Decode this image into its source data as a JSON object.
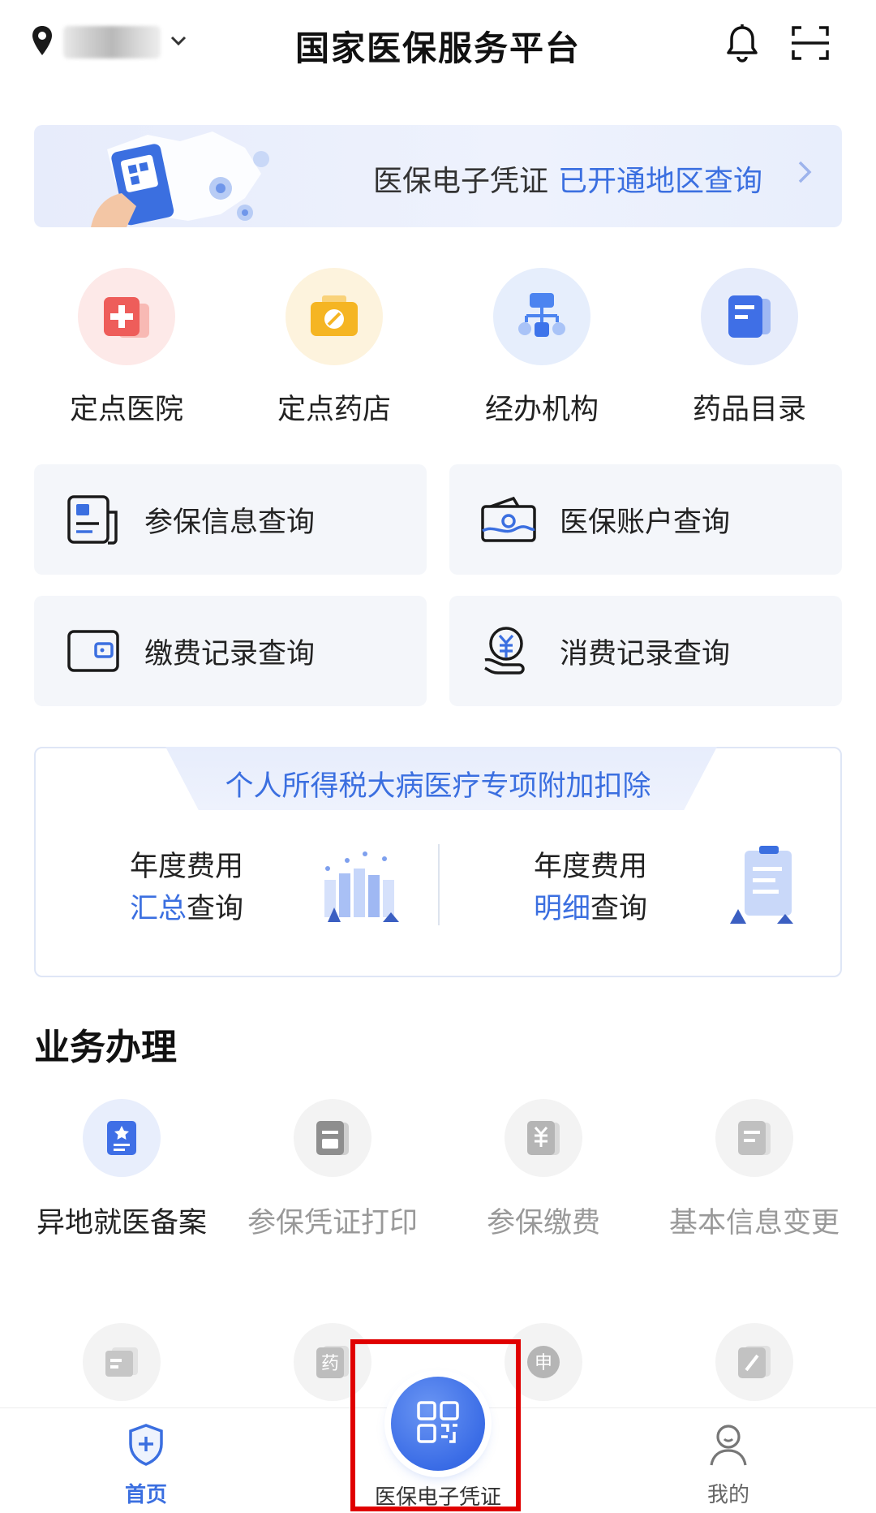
{
  "header": {
    "title": "国家医保服务平台"
  },
  "banner": {
    "text": "医保电子凭证",
    "link": "已开通地区查询"
  },
  "quick": [
    {
      "label": "定点医院",
      "icon": "hospital-icon",
      "color": "#f26464"
    },
    {
      "label": "定点药店",
      "icon": "pharmacy-icon",
      "color": "#f5b92e"
    },
    {
      "label": "经办机构",
      "icon": "agency-icon",
      "color": "#4c84f0"
    },
    {
      "label": "药品目录",
      "icon": "catalog-icon",
      "color": "#3f6fe6"
    }
  ],
  "cards": [
    {
      "label": "参保信息查询",
      "icon": "insurance-info-icon"
    },
    {
      "label": "医保账户查询",
      "icon": "account-wallet-icon"
    },
    {
      "label": "缴费记录查询",
      "icon": "payment-card-icon"
    },
    {
      "label": "消费记录查询",
      "icon": "yuan-hand-icon"
    }
  ],
  "tax": {
    "title": "个人所得税大病医疗专项附加扣除",
    "left": {
      "line1": "年度费用",
      "highlight": "汇总",
      "rest": "查询"
    },
    "right": {
      "line1": "年度费用",
      "highlight": "明细",
      "rest": "查询"
    }
  },
  "section": {
    "title": "业务办理",
    "items": [
      {
        "label": "异地就医备案",
        "icon": "badge-star-icon"
      },
      {
        "label": "参保凭证打印",
        "icon": "print-doc-icon"
      },
      {
        "label": "参保缴费",
        "icon": "yuan-doc-icon"
      },
      {
        "label": "基本信息变更",
        "icon": "edit-doc-icon"
      }
    ],
    "row2": [
      {
        "icon": "card-icon"
      },
      {
        "icon": "medicine-icon",
        "glyph": "药"
      },
      {
        "icon": "apply-icon",
        "glyph": "申"
      },
      {
        "icon": "pen-icon"
      }
    ]
  },
  "nav": {
    "home": "首页",
    "center": "医保电子凭证",
    "mine": "我的"
  },
  "colors": {
    "accent": "#3b6fe0",
    "highlight_box": "#e00000"
  }
}
